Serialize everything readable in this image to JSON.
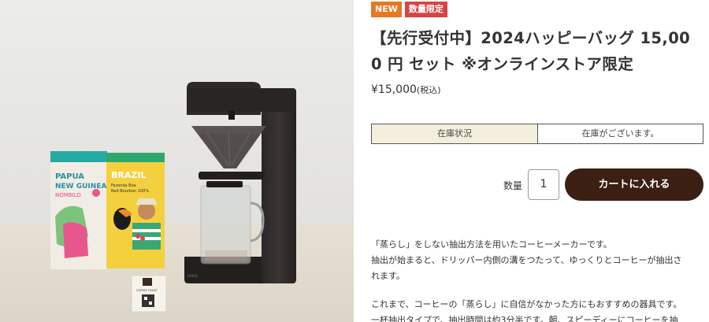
{
  "product": {
    "badges": {
      "new": "NEW",
      "limited": "数量限定"
    },
    "title_line1": "【先行受付中】2024ハッピーバッグ 15,00",
    "title_line2": "0 円 セット ※オンラインストア限定",
    "price": "¥15,000",
    "price_tax": "(税込)"
  },
  "stock": {
    "label": "在庫状況",
    "value": "在庫がございます。"
  },
  "purchase": {
    "qty_label": "数量",
    "qty_value": "1",
    "cart_button": "カートに入れる"
  },
  "description": {
    "para1_line1": "「蒸らし」をしない抽出方法を用いたコーヒーメーカーです。",
    "para1_line2": "抽出が始まると、ドリッパー内側の溝をつたって、ゆっくりとコーヒーが抽出さ",
    "para1_line3": "れます。",
    "para2_line1": "これまで、コーヒーの「蒸らし」に自信がなかった方にもおすすめの器具です。",
    "para2_line2": "一杯抽出タイプで、抽出時間は約3分半です。朝、スピーディーにコーヒーを抽"
  },
  "photo": {
    "bag1_lines": [
      "PAPUA",
      "NEW GUINEA",
      "NOMBILO"
    ],
    "bag2_lines": [
      "BRAZIL",
      "Fazenda Boa",
      "Red Bourbon 100%"
    ],
    "card_text": "COFFEE TICKET",
    "maker_brand": "HARIO"
  },
  "colors": {
    "accent_new": "#e87722",
    "accent_limited": "#d64541",
    "cart_button": "#3b1f12",
    "stock_label_bg": "#f4efdd"
  }
}
